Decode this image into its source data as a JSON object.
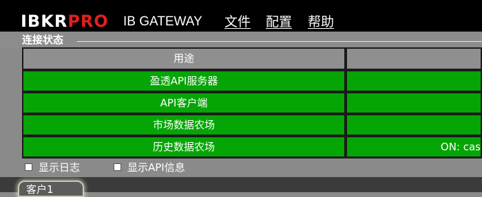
{
  "header": {
    "logo_ibkr": "IBKR",
    "logo_pro": "PRO",
    "product": "IB GATEWAY",
    "menu": [
      "文件",
      "配置",
      "帮助"
    ]
  },
  "connection": {
    "section_title": "连接状态",
    "column_header": "用途",
    "rows": [
      {
        "label": "盈透API服务器",
        "status": ""
      },
      {
        "label": "API客户端",
        "status": ""
      },
      {
        "label": "市场数据农场",
        "status": ""
      },
      {
        "label": "历史数据农场",
        "status": "ON: cas"
      }
    ]
  },
  "options": {
    "show_log": "显示日志",
    "show_api": "显示API信息"
  },
  "tabs": {
    "client": "客户1"
  },
  "colors": {
    "status_ok": "#06a506",
    "logo_accent": "#e02020",
    "menubar": "#000000"
  }
}
